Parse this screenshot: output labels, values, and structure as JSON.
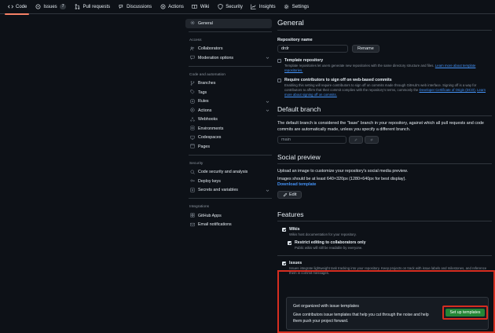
{
  "nav": {
    "tabs": [
      {
        "label": "Code",
        "icon": "code-icon"
      },
      {
        "label": "Issues",
        "icon": "issue-icon",
        "count": "7"
      },
      {
        "label": "Pull requests",
        "icon": "pull-request-icon"
      },
      {
        "label": "Discussions",
        "icon": "discussions-icon"
      },
      {
        "label": "Actions",
        "icon": "play-icon"
      },
      {
        "label": "Wiki",
        "icon": "book-icon"
      },
      {
        "label": "Security",
        "icon": "shield-icon"
      },
      {
        "label": "Insights",
        "icon": "graph-icon"
      },
      {
        "label": "Settings",
        "icon": "gear-icon"
      }
    ],
    "active_color": "#f78166"
  },
  "sidebar": {
    "general": "General",
    "access_heading": "Access",
    "collaborators": "Collaborators",
    "moderation": "Moderation options",
    "automation_heading": "Code and automation",
    "branches": "Branches",
    "tags": "Tags",
    "rules": "Rules",
    "actions": "Actions",
    "webhooks": "Webhooks",
    "environments": "Environments",
    "codespaces": "Codespaces",
    "pages": "Pages",
    "security_heading": "Security",
    "code_security": "Code security and analysis",
    "deploy_keys": "Deploy keys",
    "secrets": "Secrets and variables",
    "integrations_heading": "Integrations",
    "github_apps": "GitHub Apps",
    "email": "Email notifications"
  },
  "general": {
    "title": "General",
    "repo_name_label": "Repository name",
    "repo_name_value": "drdr",
    "rename": "Rename",
    "template_title": "Template repository",
    "template_desc": "Template repositories let users generate new repositories with the same directory structure and files.",
    "template_link": "Learn more about template repositories.",
    "signoff_title": "Require contributors to sign off on web-based commits",
    "signoff_desc": "Enabling this setting will require contributors to sign off on commits made through GitHub's web interface. Signing off is a way for contributors to affirm that their commit complies with the repository's terms, commonly the",
    "signoff_dco": "Developer Certificate of Origin (DCO).",
    "signoff_link": "Learn more about signing off on commits."
  },
  "default_branch": {
    "title": "Default branch",
    "desc": "The default branch is considered the \"base\" branch in your repository, against which all pull requests and code commits are automatically made, unless you specify a different branch.",
    "value": "main"
  },
  "social": {
    "title": "Social preview",
    "desc": "Upload an image to customize your repository's social media preview.",
    "size": "Images should be at least 640×320px (1280×640px for best display).",
    "download": "Download template",
    "edit": "Edit"
  },
  "features": {
    "title": "Features",
    "wikis_title": "Wikis",
    "wikis_desc": "Wikis host documentation for your repository.",
    "restrict_title": "Restrict editing to collaborators only",
    "restrict_desc": "Public wikis will still be readable by everyone.",
    "issues_title": "Issues",
    "issues_desc": "Issues integrate lightweight task tracking into your repository. Keep projects on track with issue labels and milestones, and reference them in commit messages.",
    "promo_title": "Get organized with issue templates",
    "promo_desc": "Give contributors issue templates that help you cut through the noise and help them push your project forward.",
    "setup_button": "Set up templates"
  }
}
